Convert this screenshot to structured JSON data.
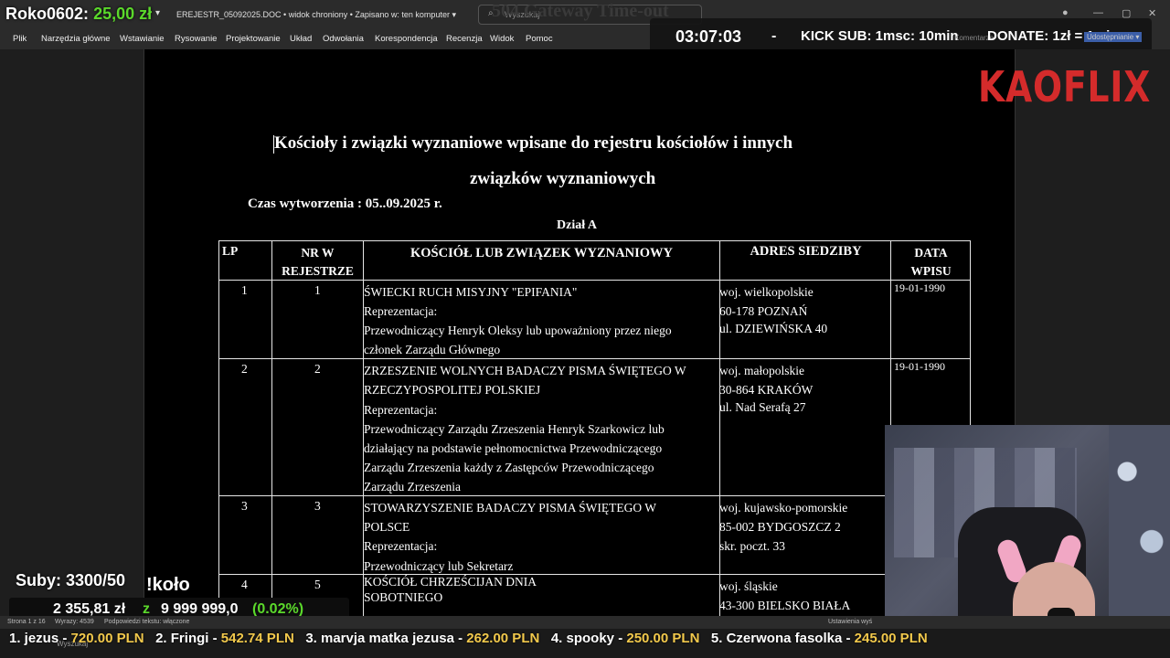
{
  "overlay": {
    "roko_name": "Roko0602:",
    "roko_amount": "25,00 zł",
    "timer": "03:07:03",
    "dash": "-",
    "kick_sub": "KICK SUB: 1msc: 10min",
    "donate": "DONATE: 1zł = 1min",
    "brand": "KAOFLIX",
    "suby": "Suby: 3300/50",
    "kolo": "!koło",
    "goal_current": "2 355,81 zł",
    "goal_z": "z",
    "goal_max": "9 999 999,0",
    "goal_percent": "(0.02%)",
    "ticker": [
      {
        "rank": "1. jezus - ",
        "amount": "720.00 PLN"
      },
      {
        "rank": "2. Fringi - ",
        "amount": "542.74 PLN"
      },
      {
        "rank": "3. marvja matka jezusa - ",
        "amount": "262.00 PLN"
      },
      {
        "rank": "4. spooky - ",
        "amount": "250.00 PLN"
      },
      {
        "rank": "5. Czerwona fasolka - ",
        "amount": "245.00 PLN"
      }
    ]
  },
  "titlebar": {
    "dropdown": "▾",
    "doc_title": "EREJESTR_05092025.DOC  •  widok chroniony  •  Zapisano w: ten komputer ▾",
    "search_placeholder": "Wyszukaj",
    "gateway": "504 Gateway Time-out",
    "komentarze": "Komentarze",
    "udostepnianie": "Udostępnianie ▾"
  },
  "menu": [
    "Plik",
    "Narzędzia główne",
    "Wstawianie",
    "Rysowanie",
    "Projektowanie",
    "Układ",
    "Odwołania",
    "Korespondencja",
    "Recenzja",
    "Widok",
    "Pomoc"
  ],
  "document": {
    "heading_line1": "Kościoły i związki wyznaniowe wpisane do rejestru kościołów i innych",
    "heading_line2": "związków wyznaniowych",
    "czas": "Czas wytworzenia : 05..09.2025 r.",
    "dzial": "Dział A",
    "headers": {
      "lp": "LP",
      "nr1": "NR W",
      "nr2": "REJESTRZE",
      "kosciol": "KOŚCIÓŁ LUB ZWIĄZEK WYZNANIOWY",
      "adres": "ADRES SIEDZIBY",
      "data1": "DATA",
      "data2": "WPISU"
    },
    "rows": [
      {
        "lp": "1",
        "nr": "1",
        "name": [
          "ŚWIECKI RUCH MISYJNY \"EPIFANIA\"",
          "Reprezentacja:",
          "Przewodniczący Henryk Oleksy lub upoważniony przez niego",
          " członek Zarządu Głównego"
        ],
        "addr": [
          "woj. wielkopolskie",
          "60-178 POZNAŃ",
          "ul. DZIEWIŃSKA 40"
        ],
        "date": "19-01-1990"
      },
      {
        "lp": "2",
        "nr": "2",
        "name": [
          "ZRZESZENIE WOLNYCH BADACZY PISMA ŚWIĘTEGO W",
          " RZECZYPOSPOLITEJ POLSKIEJ",
          "Reprezentacja:",
          "Przewodniczący Zarządu Zrzeszenia Henryk Szarkowicz lub",
          " działający na podstawie pełnomocnictwa Przewodniczącego",
          " Zarządu Zrzeszenia każdy z Zastępców Przewodniczącego",
          " Zarządu Zrzeszenia"
        ],
        "addr": [
          "woj. małopolskie",
          "30-864 KRAKÓW",
          "ul. Nad Serafą 27"
        ],
        "date": "19-01-1990"
      },
      {
        "lp": "3",
        "nr": "3",
        "name": [
          "STOWARZYSZENIE BADACZY PISMA ŚWIĘTEGO W",
          " POLSCE",
          "Reprezentacja:",
          "Przewodniczący lub Sekretarz"
        ],
        "addr": [
          "woj. kujawsko-pomorskie",
          "85-002 BYDGOSZCZ 2",
          "skr. poczt. 33"
        ],
        "date": ""
      },
      {
        "lp": "4",
        "nr": "5",
        "name": [
          "KOŚCIÓŁ CHRZEŚCIJAN DNIA",
          "SOBOTNIEGO"
        ],
        "addr": [
          "woj. śląskie",
          "43-300 BIELSKO BIAŁA"
        ],
        "date": ""
      }
    ]
  },
  "statusbar": {
    "page": "Strona 1 z 16",
    "words": "Wyrazy: 4539",
    "predict": "Podpowiedzi tekstu: włączone",
    "settings": "Ustawienia wyś"
  },
  "taskbar": {
    "search": "Wyszukaj"
  }
}
